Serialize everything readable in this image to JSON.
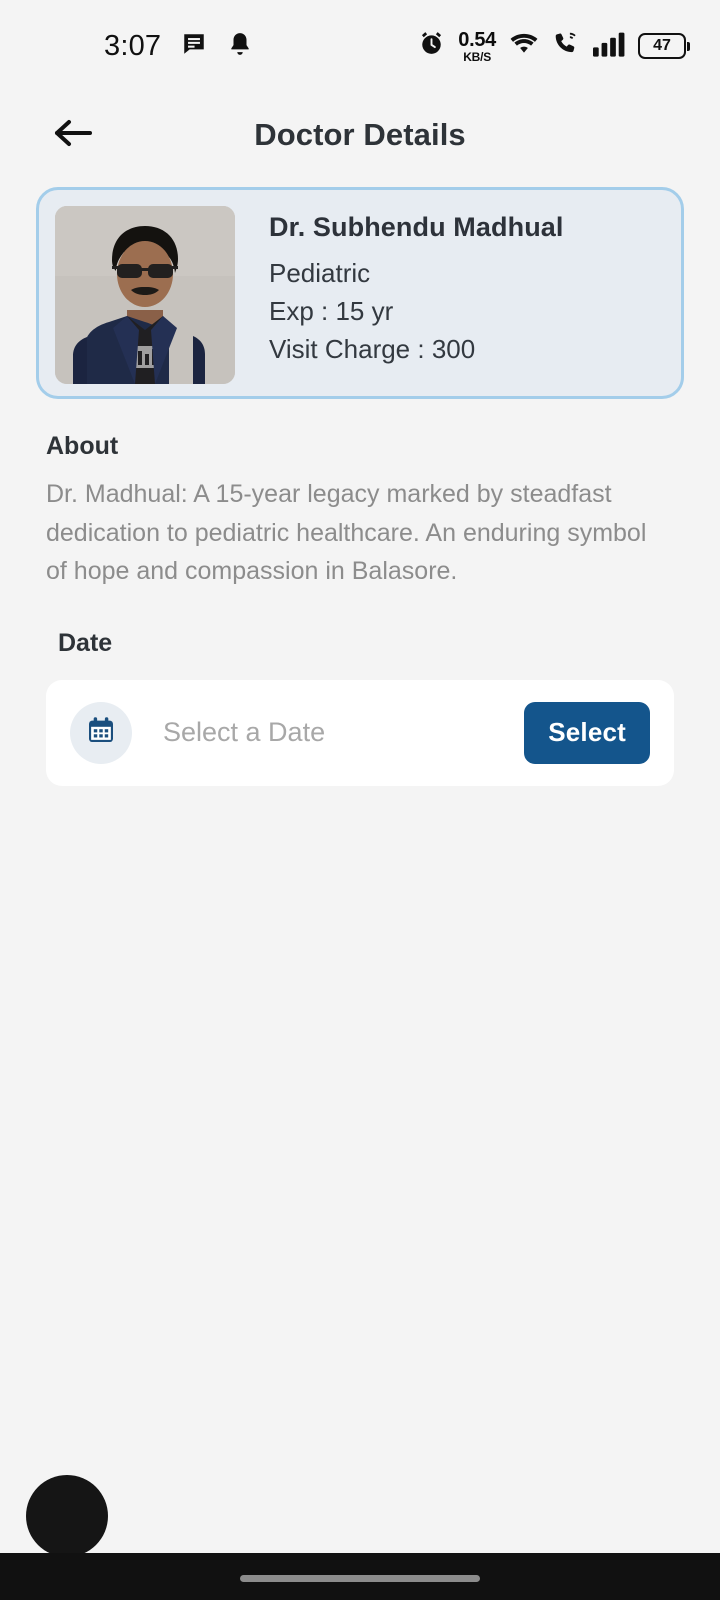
{
  "status_bar": {
    "time": "3:07",
    "left_icons": [
      "message-icon",
      "bell-icon"
    ],
    "net_speed_value": "0.54",
    "net_speed_unit": "KB/S",
    "right_icons": [
      "alarm-icon",
      "wifi-icon",
      "call-wifi-icon",
      "signal-icon"
    ],
    "battery_level": "47"
  },
  "header": {
    "back_icon": "arrow-left-icon",
    "title": "Doctor Details"
  },
  "doctor_card": {
    "photo_alt": "doctor-portrait",
    "name": "Dr. Subhendu Madhual",
    "specialty": "Pediatric",
    "experience": "Exp : 15 yr",
    "visit_charge": "Visit Charge : 300",
    "border_color": "#a3cdea",
    "background_color": "#e7ecf2"
  },
  "about": {
    "title": "About",
    "text": "Dr. Madhual: A 15-year legacy marked by steadfast dedication to pediatric healthcare. An enduring symbol of hope and compassion in Balasore."
  },
  "date_section": {
    "title": "Date",
    "calendar_icon": "calendar-icon",
    "placeholder": "Select a Date",
    "value": "",
    "select_label": "Select",
    "select_color": "#14558c"
  },
  "floating_button": {
    "name": "floating-action-button",
    "color": "#151515"
  },
  "nav_bar": {
    "gesture_pill": "home-gesture-pill",
    "color": "#111111"
  },
  "page_background": "#f4f4f4"
}
